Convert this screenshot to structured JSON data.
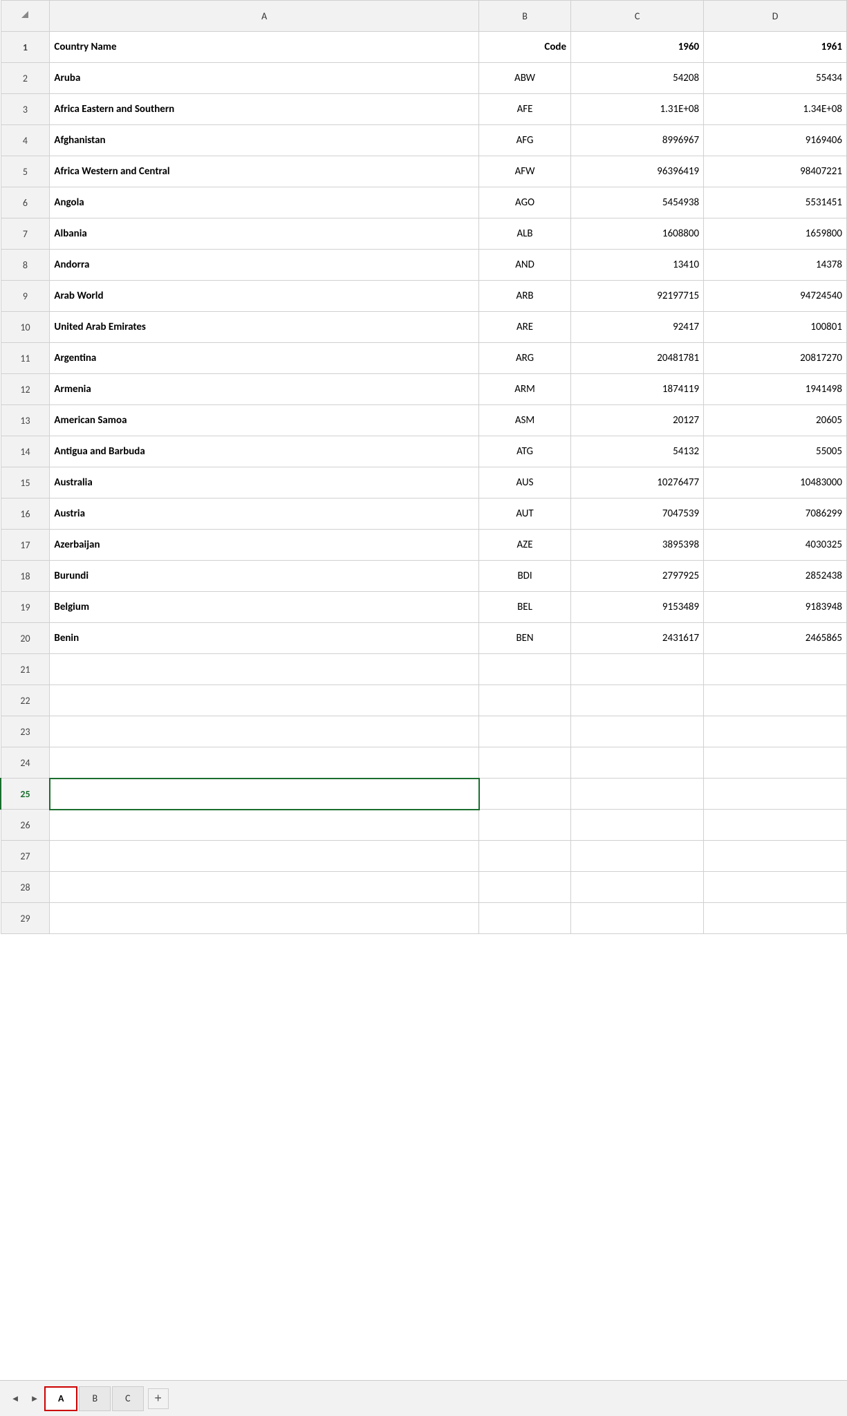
{
  "columns": {
    "row_num": "",
    "a_label": "A",
    "b_label": "B",
    "c_label": "C",
    "d_label": "D"
  },
  "header_row": {
    "row_num": "1",
    "country_name": "Country Name",
    "code": "Code",
    "year_1960": "1960",
    "year_1961": "1961"
  },
  "rows": [
    {
      "num": "2",
      "name": "Aruba",
      "code": "ABW",
      "y1960": "54208",
      "y1961": "55434"
    },
    {
      "num": "3",
      "name": "Africa Eastern and Southern",
      "code": "AFE",
      "y1960": "1.31E+08",
      "y1961": "1.34E+08"
    },
    {
      "num": "4",
      "name": "Afghanistan",
      "code": "AFG",
      "y1960": "8996967",
      "y1961": "9169406"
    },
    {
      "num": "5",
      "name": "Africa Western and Central",
      "code": "AFW",
      "y1960": "96396419",
      "y1961": "98407221"
    },
    {
      "num": "6",
      "name": "Angola",
      "code": "AGO",
      "y1960": "5454938",
      "y1961": "5531451"
    },
    {
      "num": "7",
      "name": "Albania",
      "code": "ALB",
      "y1960": "1608800",
      "y1961": "1659800"
    },
    {
      "num": "8",
      "name": "Andorra",
      "code": "AND",
      "y1960": "13410",
      "y1961": "14378"
    },
    {
      "num": "9",
      "name": "Arab World",
      "code": "ARB",
      "y1960": "92197715",
      "y1961": "94724540"
    },
    {
      "num": "10",
      "name": "United Arab Emirates",
      "code": "ARE",
      "y1960": "92417",
      "y1961": "100801"
    },
    {
      "num": "11",
      "name": "Argentina",
      "code": "ARG",
      "y1960": "20481781",
      "y1961": "20817270"
    },
    {
      "num": "12",
      "name": "Armenia",
      "code": "ARM",
      "y1960": "1874119",
      "y1961": "1941498"
    },
    {
      "num": "13",
      "name": "American Samoa",
      "code": "ASM",
      "y1960": "20127",
      "y1961": "20605"
    },
    {
      "num": "14",
      "name": "Antigua and Barbuda",
      "code": "ATG",
      "y1960": "54132",
      "y1961": "55005"
    },
    {
      "num": "15",
      "name": "Australia",
      "code": "AUS",
      "y1960": "10276477",
      "y1961": "10483000"
    },
    {
      "num": "16",
      "name": "Austria",
      "code": "AUT",
      "y1960": "7047539",
      "y1961": "7086299"
    },
    {
      "num": "17",
      "name": "Azerbaijan",
      "code": "AZE",
      "y1960": "3895398",
      "y1961": "4030325"
    },
    {
      "num": "18",
      "name": "Burundi",
      "code": "BDI",
      "y1960": "2797925",
      "y1961": "2852438"
    },
    {
      "num": "19",
      "name": "Belgium",
      "code": "BEL",
      "y1960": "9153489",
      "y1961": "9183948"
    },
    {
      "num": "20",
      "name": "Benin",
      "code": "BEN",
      "y1960": "2431617",
      "y1961": "2465865"
    }
  ],
  "empty_rows": [
    "21",
    "22",
    "23",
    "24",
    "25",
    "26",
    "27",
    "28",
    "29"
  ],
  "selected_row": "25",
  "tabs": {
    "active": "A",
    "inactive": [
      "B",
      "C"
    ],
    "add_label": "+"
  },
  "nav": {
    "prev": "◄",
    "next": "►"
  }
}
